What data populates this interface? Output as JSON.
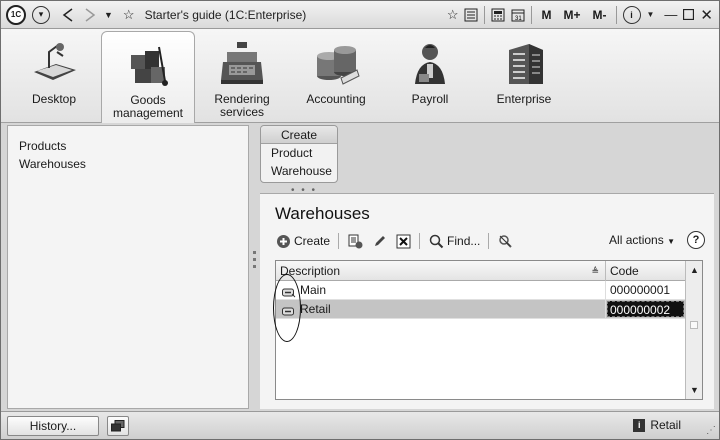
{
  "window": {
    "title": "Starter's guide  (1C:Enterprise)",
    "logo_text": "1C",
    "memory_buttons": [
      "M",
      "M+",
      "M-"
    ]
  },
  "sections": [
    {
      "label": "Desktop",
      "icon": "desktop-icon",
      "active": false
    },
    {
      "label": "Goods management",
      "icon": "goods-icon",
      "active": true
    },
    {
      "label": "Rendering services",
      "icon": "cash-register-icon",
      "active": false
    },
    {
      "label": "Accounting",
      "icon": "coins-icon",
      "active": false
    },
    {
      "label": "Payroll",
      "icon": "person-icon",
      "active": false
    },
    {
      "label": "Enterprise",
      "icon": "building-icon",
      "active": false
    }
  ],
  "nav": {
    "items": [
      "Products",
      "Warehouses"
    ]
  },
  "create_menu": {
    "header": "Create",
    "items": [
      "Product",
      "Warehouse"
    ]
  },
  "form": {
    "title": "Warehouses",
    "toolbar": {
      "create_label": "Create",
      "find_label": "Find...",
      "all_actions_label": "All actions",
      "help_label": "?"
    },
    "table": {
      "columns": [
        "Description",
        "Code"
      ],
      "rows": [
        {
          "description": "Main",
          "code": "000000001",
          "selected": false
        },
        {
          "description": "Retail",
          "code": "000000002",
          "selected": true
        }
      ]
    }
  },
  "bottom": {
    "history_label": "History...",
    "status_text": "Retail"
  }
}
